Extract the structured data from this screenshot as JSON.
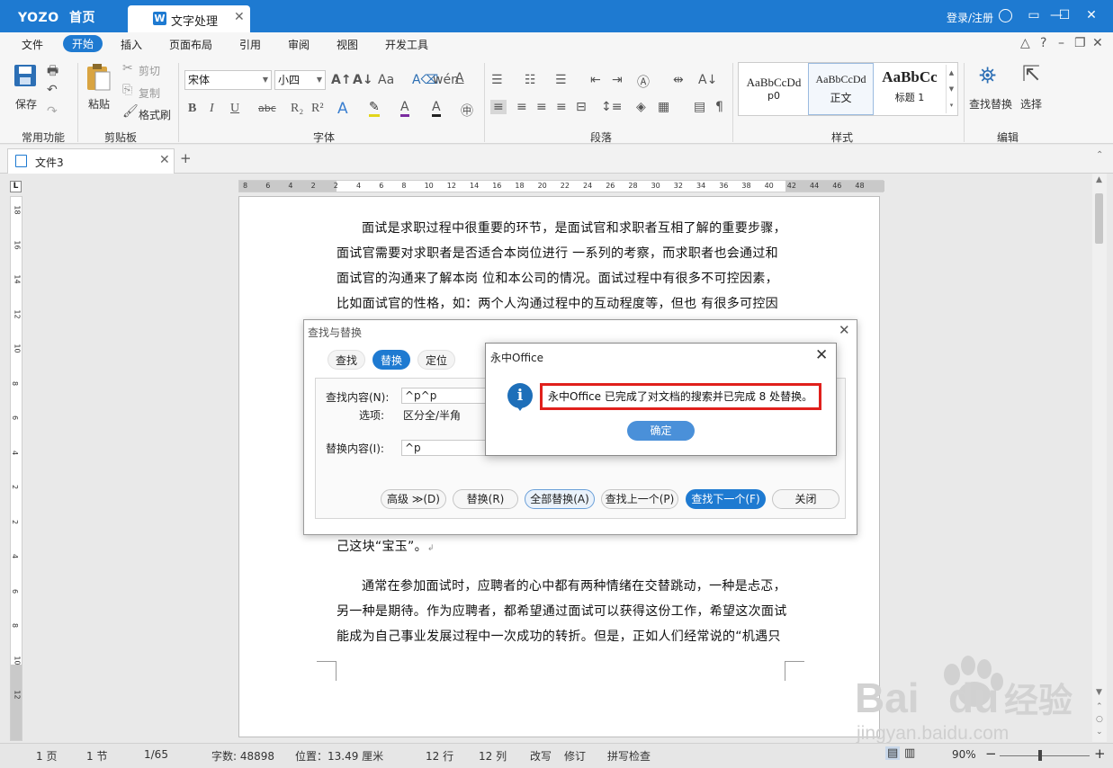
{
  "titlebar": {
    "brand": "YOZO",
    "home": "首页",
    "app_tab": "文字处理",
    "app_tab_icon": "W",
    "login": "登录/注册"
  },
  "menu": {
    "items": [
      "文件",
      "开始",
      "插入",
      "页面布局",
      "引用",
      "审阅",
      "视图",
      "开发工具"
    ],
    "active": "开始"
  },
  "ribbon": {
    "common": {
      "save": "保存",
      "label": "常用功能"
    },
    "clipboard": {
      "paste": "粘贴",
      "cut": "剪切",
      "copy": "复制",
      "format_painter": "格式刷",
      "label": "剪贴板"
    },
    "font": {
      "name": "宋体",
      "size": "小四",
      "label": "字体"
    },
    "paragraph": {
      "label": "段落"
    },
    "styles": {
      "items": [
        {
          "preview": "AaBbCcDd",
          "name": "p0"
        },
        {
          "preview": "AaBbCcDd",
          "name": "正文"
        },
        {
          "preview": "AaBbCc",
          "name": "标题 1"
        }
      ],
      "label": "样式"
    },
    "edit": {
      "find_replace": "查找替换",
      "select": "选择",
      "label": "编辑"
    }
  },
  "doc_tab": {
    "title": "文件3"
  },
  "ruler": {
    "h_numbers": [
      "8",
      "6",
      "4",
      "2",
      "2",
      "4",
      "6",
      "8",
      "10",
      "12",
      "14",
      "16",
      "18",
      "20",
      "22",
      "24",
      "26",
      "28",
      "30",
      "32",
      "34",
      "36",
      "38",
      "40",
      "42",
      "44",
      "46",
      "48"
    ],
    "v_numbers": [
      "18",
      "16",
      "14",
      "12",
      "10",
      "8",
      "6",
      "4",
      "2",
      "2",
      "4",
      "6",
      "8",
      "10",
      "12"
    ]
  },
  "document": {
    "lines": [
      "面试是求职过程中很重要的环节，是面试官和求职者互相了解的重要步骤，",
      "面试官需要对求职者是否适合本岗位进行  一系列的考察，而求职者也会通过和",
      "面试官的沟通来了解本岗  位和本公司的情况。面试过程中有很多不可控因素，",
      "比如面试官的性格，如：两个人沟通过程中的互动程度等，但也  有很多可控因"
    ],
    "after_line": "己这块“宝玉”。",
    "para2": [
      "通常在参加面试时，应聘者的心中都有两种情绪在交替跳动，一种是忐忑，",
      "另一种是期待。作为应聘者，都希望通过面试可以获得这份工作，希望这次面试",
      "能成为自己事业发展过程中一次成功的转折。但是，正如人们经常说的“机遇只"
    ]
  },
  "find_dialog": {
    "title": "查找与替换",
    "tabs": [
      "查找",
      "替换",
      "定位"
    ],
    "active_tab": "替换",
    "find_label": "查找内容(N):",
    "find_value": "^p^p",
    "options_label": "选项:",
    "options_value": "区分全/半角",
    "replace_label": "替换内容(I):",
    "replace_value": "^p",
    "buttons": {
      "advanced": "高级 ≫(D)",
      "replace": "替换(R)",
      "replace_all": "全部替换(A)",
      "find_prev": "查找上一个(P)",
      "find_next": "查找下一个(F)",
      "close": "关闭"
    }
  },
  "message_box": {
    "title": "永中Office",
    "message": "永中Office 已完成了对文档的搜索并已完成 8 处替换。",
    "ok": "确定",
    "highlight_color": "#e0201c"
  },
  "statusbar": {
    "page": "1 页",
    "section": "1 节",
    "pages": "1/65",
    "words": "字数: 48898",
    "position": "位置：13.49 厘米",
    "line": "12 行",
    "column": "12 列",
    "overwrite": "改写",
    "revise": "修订",
    "spell": "拼写检查",
    "zoom": "90%"
  },
  "watermark": {
    "brand": "Bai",
    "brand2": "du",
    "cn": "经验",
    "url": "jingyan.baidu.com"
  },
  "colors": {
    "accent": "#1e7ad1",
    "highlight": "#e0201c"
  }
}
